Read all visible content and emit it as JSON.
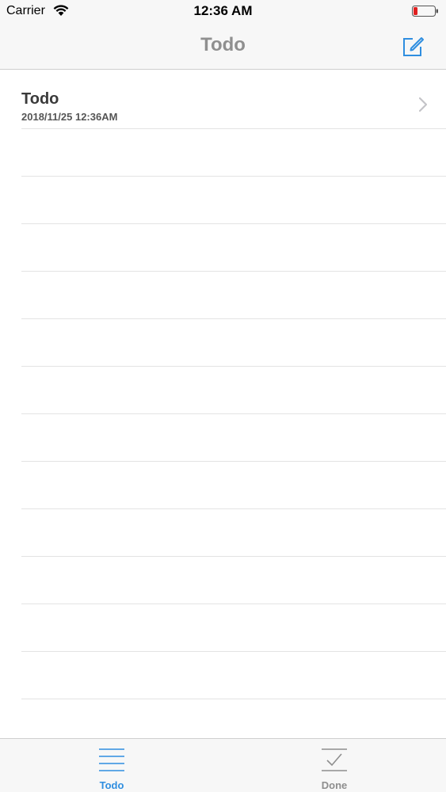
{
  "status_bar": {
    "carrier": "Carrier",
    "time": "12:36 AM",
    "wifi_icon": "wifi-icon",
    "battery_icon": "battery-low-icon",
    "battery_color": "#e02020"
  },
  "nav": {
    "title": "Todo",
    "compose_icon": "compose-icon"
  },
  "list": {
    "items": [
      {
        "title": "Todo",
        "subtitle": "2018/11/25 12:36AM",
        "accessory_icon": "chevron-right-icon"
      }
    ]
  },
  "tab_bar": {
    "tabs": [
      {
        "label": "Todo",
        "icon": "list-icon",
        "selected": true
      },
      {
        "label": "Done",
        "icon": "checkmark-icon",
        "selected": false
      }
    ]
  },
  "colors": {
    "accent": "#2f8ee0",
    "inactive": "#8e8e8e",
    "nav_title": "#8f8f8f",
    "bar_background": "#f7f7f7",
    "separator": "#e3e3e3"
  }
}
